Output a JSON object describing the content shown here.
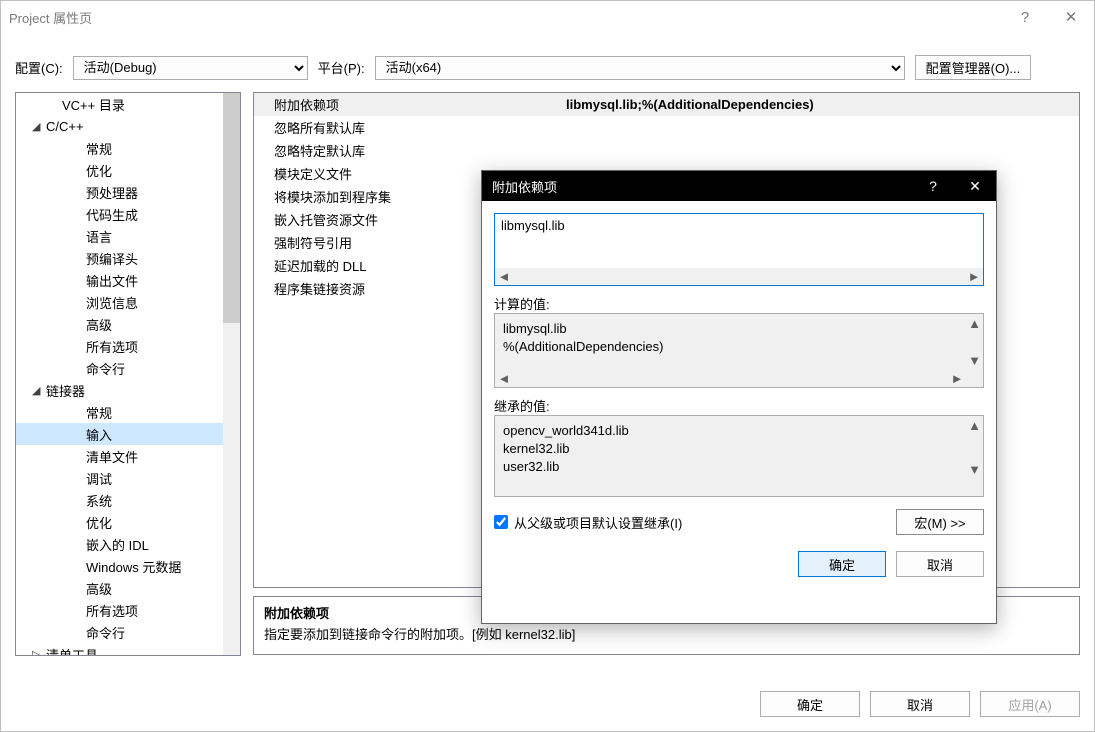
{
  "window": {
    "title": "Project 属性页",
    "help_icon": "?",
    "close_icon": "✕"
  },
  "config_row": {
    "config_label": "配置(C):",
    "config_value": "活动(Debug)",
    "platform_label": "平台(P):",
    "platform_value": "活动(x64)",
    "config_mgr_btn": "配置管理器(O)..."
  },
  "tree": {
    "items": [
      {
        "lvl": 0,
        "caret": "",
        "label": "VC++ 目录",
        "sel": false
      },
      {
        "lvl": 1,
        "caret": "◢",
        "label": "C/C++",
        "sel": false
      },
      {
        "lvl": 2,
        "caret": "",
        "label": "常规",
        "sel": false
      },
      {
        "lvl": 2,
        "caret": "",
        "label": "优化",
        "sel": false
      },
      {
        "lvl": 2,
        "caret": "",
        "label": "预处理器",
        "sel": false
      },
      {
        "lvl": 2,
        "caret": "",
        "label": "代码生成",
        "sel": false
      },
      {
        "lvl": 2,
        "caret": "",
        "label": "语言",
        "sel": false
      },
      {
        "lvl": 2,
        "caret": "",
        "label": "预编译头",
        "sel": false
      },
      {
        "lvl": 2,
        "caret": "",
        "label": "输出文件",
        "sel": false
      },
      {
        "lvl": 2,
        "caret": "",
        "label": "浏览信息",
        "sel": false
      },
      {
        "lvl": 2,
        "caret": "",
        "label": "高级",
        "sel": false
      },
      {
        "lvl": 2,
        "caret": "",
        "label": "所有选项",
        "sel": false
      },
      {
        "lvl": 2,
        "caret": "",
        "label": "命令行",
        "sel": false
      },
      {
        "lvl": 1,
        "caret": "◢",
        "label": "链接器",
        "sel": false
      },
      {
        "lvl": 2,
        "caret": "",
        "label": "常规",
        "sel": false
      },
      {
        "lvl": 2,
        "caret": "",
        "label": "输入",
        "sel": true
      },
      {
        "lvl": 2,
        "caret": "",
        "label": "清单文件",
        "sel": false
      },
      {
        "lvl": 2,
        "caret": "",
        "label": "调试",
        "sel": false
      },
      {
        "lvl": 2,
        "caret": "",
        "label": "系统",
        "sel": false
      },
      {
        "lvl": 2,
        "caret": "",
        "label": "优化",
        "sel": false
      },
      {
        "lvl": 2,
        "caret": "",
        "label": "嵌入的 IDL",
        "sel": false
      },
      {
        "lvl": 2,
        "caret": "",
        "label": "Windows 元数据",
        "sel": false
      },
      {
        "lvl": 2,
        "caret": "",
        "label": "高级",
        "sel": false
      },
      {
        "lvl": 2,
        "caret": "",
        "label": "所有选项",
        "sel": false
      },
      {
        "lvl": 2,
        "caret": "",
        "label": "命令行",
        "sel": false
      },
      {
        "lvl": 1,
        "caret": "▷",
        "label": "清单工具",
        "sel": false
      }
    ]
  },
  "prop_grid": {
    "rows": [
      {
        "name": "附加依赖项",
        "val": "libmysql.lib;%(AdditionalDependencies)",
        "sel": true
      },
      {
        "name": "忽略所有默认库",
        "val": "",
        "sel": false
      },
      {
        "name": "忽略特定默认库",
        "val": "",
        "sel": false
      },
      {
        "name": "模块定义文件",
        "val": "",
        "sel": false
      },
      {
        "name": "将模块添加到程序集",
        "val": "",
        "sel": false
      },
      {
        "name": "嵌入托管资源文件",
        "val": "",
        "sel": false
      },
      {
        "name": "强制符号引用",
        "val": "",
        "sel": false
      },
      {
        "name": "延迟加载的 DLL",
        "val": "",
        "sel": false
      },
      {
        "name": "程序集链接资源",
        "val": "",
        "sel": false
      }
    ]
  },
  "desc": {
    "title": "附加依赖项",
    "text": "指定要添加到链接命令行的附加项。[例如 kernel32.lib]"
  },
  "bottom": {
    "ok": "确定",
    "cancel": "取消",
    "apply": "应用(A)"
  },
  "modal": {
    "title": "附加依赖项",
    "help_icon": "?",
    "close_icon": "✕",
    "edit_value": "libmysql.lib",
    "calc_label": "计算的值:",
    "calc_lines": [
      "libmysql.lib",
      "%(AdditionalDependencies)"
    ],
    "inh_label": "继承的值:",
    "inh_lines": [
      "opencv_world341d.lib",
      "kernel32.lib",
      "user32.lib"
    ],
    "inherit_chk": "从父级或项目默认设置继承(I)",
    "macro_btn": "宏(M) >>",
    "ok": "确定",
    "cancel": "取消"
  }
}
